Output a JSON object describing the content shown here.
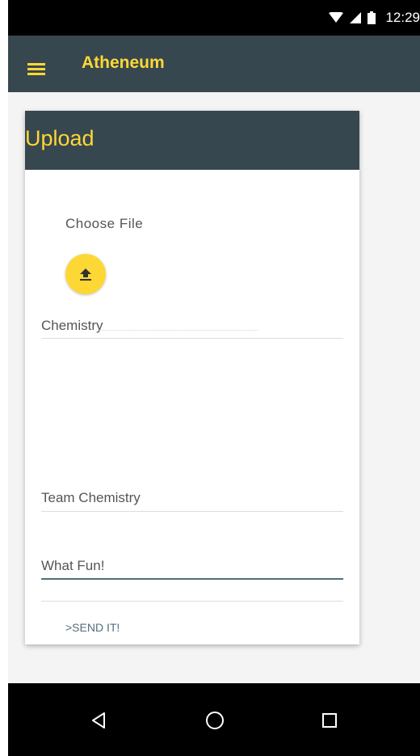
{
  "status_bar": {
    "time": "12:29"
  },
  "app_bar": {
    "menu_icon": "menu-icon",
    "title": "Atheneum"
  },
  "card": {
    "title": "Upload",
    "choose_file_label": "Choose File",
    "upload_icon": "upload-icon",
    "fields": {
      "subject": {
        "value": "Chemistry"
      },
      "team": {
        "value": "Team Chemistry"
      },
      "comment": {
        "value": "What Fun!"
      }
    },
    "send_label": ">SEND IT!"
  },
  "nav_bar": {
    "back_icon": "back-icon",
    "home_icon": "home-icon",
    "recents_icon": "recents-icon"
  },
  "colors": {
    "accent": "#fdd835",
    "primary": "#37474f",
    "active_line": "#546e7a"
  }
}
